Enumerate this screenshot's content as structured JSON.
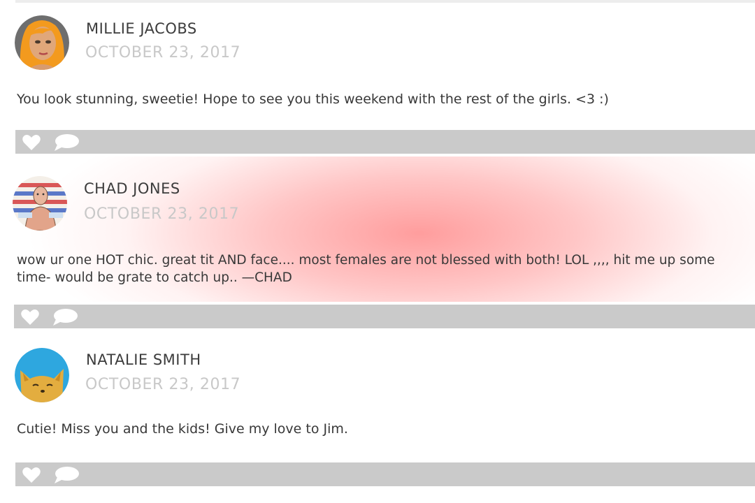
{
  "comments": [
    {
      "author": "MILLIE JACOBS",
      "date": "OCTOBER 23, 2017",
      "text": "You look stunning, sweetie! Hope to see you this weekend with the rest of the girls. <3 :)",
      "avatar_icon": "woman-orange-hair-avatar",
      "highlighted": false
    },
    {
      "author": "CHAD JONES",
      "date": "OCTOBER 23, 2017",
      "text": "wow ur one HOT chic. great tit AND face.... most females are not blessed with both! LOL ,,,, hit me up some time- would be grate to catch up..  —CHAD",
      "avatar_icon": "man-flag-avatar",
      "highlighted": true,
      "highlight_color": "#ff9a9a"
    },
    {
      "author": "NATALIE SMITH",
      "date": "OCTOBER 23, 2017",
      "text": "Cutie! Miss you and the kids! Give my love to Jim.",
      "avatar_icon": "cat-avatar",
      "highlighted": false
    }
  ],
  "actions": {
    "like_icon": "heart-icon",
    "reply_icon": "speech-bubble-icon"
  },
  "colors": {
    "action_bar": "#cacaca",
    "author_text": "#3c3c3c",
    "date_text": "#c8c8c8",
    "body_text": "#383838"
  }
}
